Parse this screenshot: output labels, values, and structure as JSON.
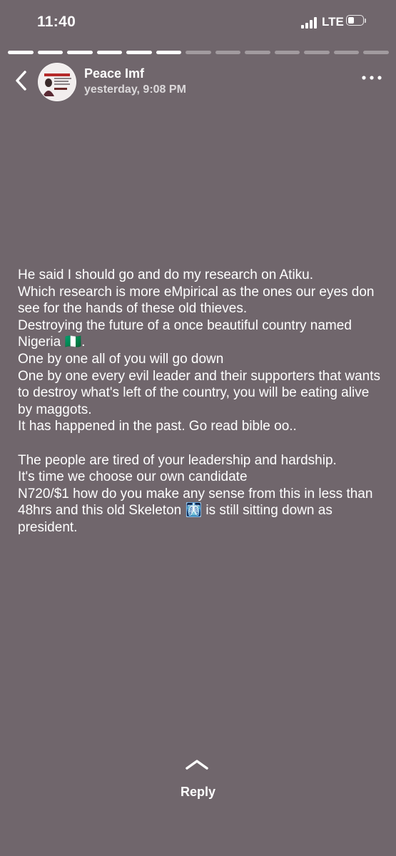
{
  "status_bar": {
    "time": "11:40",
    "network": "LTE",
    "signal_icon": "signal-bars-icon",
    "battery_icon": "battery-low-icon"
  },
  "story_progress": {
    "total_segments": 13,
    "completed_segments": 6
  },
  "header": {
    "back_icon": "chevron-left-icon",
    "author_name": "Peace Imf",
    "timestamp": "yesterday, 9:08 PM",
    "more_icon": "ellipsis-icon"
  },
  "message": {
    "lines_part1": [
      "He said I should go and do my research on Atiku.",
      "Which research is more eMpirical as the ones our eyes don see for the hands of these old thieves.",
      "Destroying the future of a once beautiful country named Nigeria 🇳🇬.",
      "One by one all of you will go down",
      "One by one every evil leader and their supporters that wants to destroy what's left of the country, you will be eating alive by maggots.",
      "It has happened in the past. Go read bible oo.."
    ],
    "lines_part2": [
      "The people are tired of your leadership and hardship.",
      "It's time we choose our own candidate",
      "N720/$1 how do you make any sense from this in less than 48hrs and this old Skeleton 🩻 is still sitting down as president."
    ]
  },
  "footer": {
    "reply_icon": "chevron-up-icon",
    "reply_label": "Reply"
  },
  "colors": {
    "background": "#70666c",
    "text": "#ffffff"
  }
}
